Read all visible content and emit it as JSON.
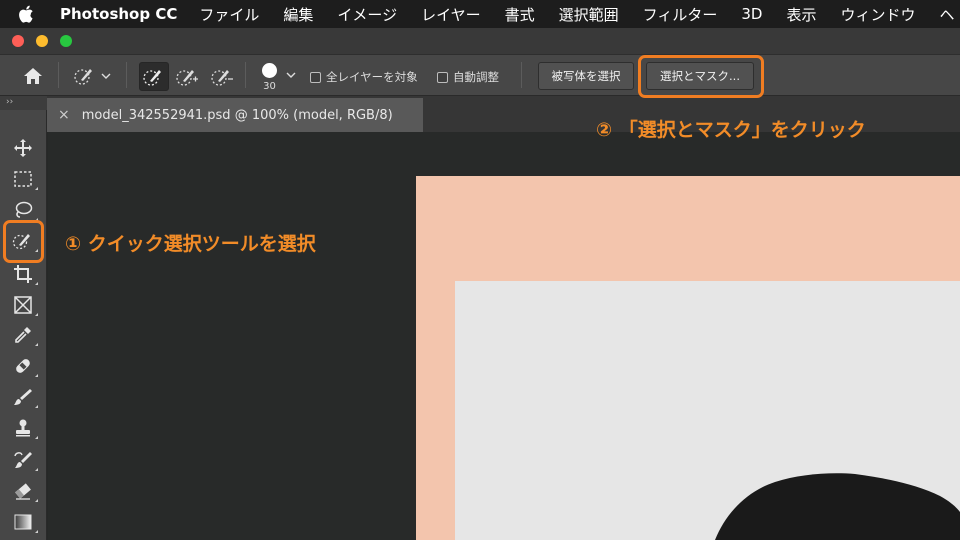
{
  "menubar": {
    "app_name": "Photoshop CC",
    "items": [
      "ファイル",
      "編集",
      "イメージ",
      "レイヤー",
      "書式",
      "選択範囲",
      "フィルター",
      "3D",
      "表示",
      "ウィンドウ",
      "ヘ"
    ]
  },
  "options_bar": {
    "brush_size": "30",
    "sample_all_layers_label": "全レイヤーを対象",
    "auto_enhance_label": "自動調整",
    "select_subject_label": "被写体を選択",
    "select_and_mask_label": "選択とマスク..."
  },
  "toolbar": {
    "collapse_label": "››"
  },
  "document": {
    "close_symbol": "×",
    "tab_title": "model_342552941.psd @ 100% (model, RGB/8)"
  },
  "annotations": {
    "step1": "① クイック選択ツールを選択",
    "step2": "② 「選択とマスク」をクリック"
  },
  "colors": {
    "highlight": "#f07d22",
    "canvas_peach": "#f3c5ad",
    "canvas_grey": "#e6e6e6"
  },
  "icons": [
    "apple-icon",
    "home-icon",
    "quick-selection-icon",
    "chevron-down-icon",
    "new-selection-icon",
    "add-to-selection-icon",
    "subtract-from-selection-icon",
    "brush-preview-icon",
    "move-icon",
    "marquee-icon",
    "lasso-icon",
    "crop-icon",
    "frame-icon",
    "eyedropper-icon",
    "healing-brush-icon",
    "brush-icon",
    "clone-stamp-icon",
    "history-brush-icon",
    "eraser-icon",
    "gradient-icon"
  ]
}
